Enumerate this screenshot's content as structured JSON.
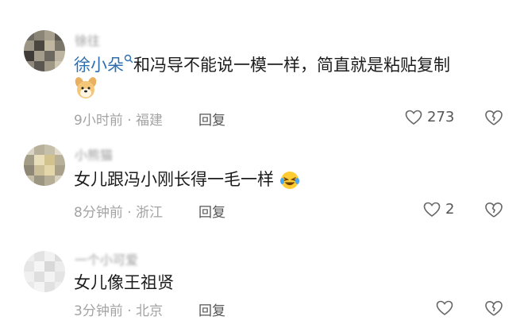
{
  "comments": [
    {
      "username": "徐往",
      "mention": "徐小朵",
      "text": "和冯导不能说一模一样，简直就是粘贴复制",
      "time_location": "9小时前 · 福建",
      "reply_label": "回复",
      "like_count": "273",
      "emoji_icon": "dog-emoji"
    },
    {
      "username": "小熊猫",
      "text": "女儿跟冯小刚长得一毛一样",
      "time_location": "8分钟前 · 浙江",
      "reply_label": "回复",
      "like_count": "2",
      "emoji_icon": "laughing-crying-emoji"
    },
    {
      "username": "一个小可爱",
      "text": "女儿像王祖贤",
      "time_location": "3分钟前 · 北京",
      "reply_label": "回复",
      "like_count": ""
    }
  ],
  "icons": {
    "like": "heart-outline-icon",
    "dislike": "broken-heart-icon",
    "mention_marker": "search-icon"
  }
}
